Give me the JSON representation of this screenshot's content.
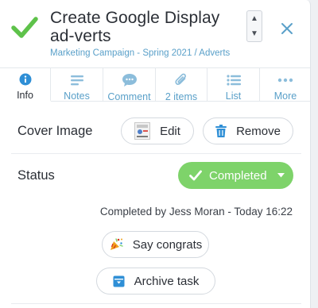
{
  "task": {
    "title": "Create Google Display ad-verts",
    "breadcrumb": "Marketing Campaign - Spring 2021 / Adverts"
  },
  "tabs": [
    {
      "label": "Info",
      "icon": "info-icon",
      "active": true
    },
    {
      "label": "Notes",
      "icon": "notes-icon"
    },
    {
      "label": "Comment",
      "icon": "comment-icon"
    },
    {
      "label": "2 items",
      "icon": "paperclip-icon"
    },
    {
      "label": "List",
      "icon": "list-icon"
    },
    {
      "label": "More",
      "icon": "more-icon"
    }
  ],
  "cover": {
    "label": "Cover Image",
    "edit_label": "Edit",
    "remove_label": "Remove"
  },
  "status": {
    "label": "Status",
    "value": "Completed",
    "completed_by": "Completed by Jess Moran - Today 16:22"
  },
  "actions": {
    "congrats_label": "Say congrats",
    "archive_label": "Archive task"
  },
  "colors": {
    "accent": "#5aa0c9",
    "status_green": "#7ed36a",
    "check_green": "#5ec24a",
    "trash_blue": "#2f8fd6"
  }
}
